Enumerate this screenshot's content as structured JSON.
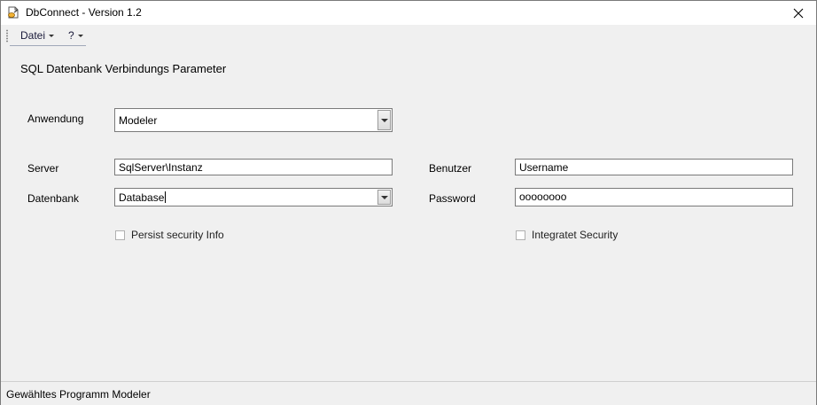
{
  "window": {
    "title": "DbConnect - Version 1.2",
    "close_glyph": "✕"
  },
  "menu": {
    "items": [
      {
        "label": "Datei"
      },
      {
        "label": "?"
      }
    ]
  },
  "form": {
    "heading": "SQL Datenbank Verbindungs Parameter",
    "anwendung_label": "Anwendung",
    "anwendung_value": "Modeler",
    "server_label": "Server",
    "server_value": "SqlServer\\Instanz",
    "datenbank_label": "Datenbank",
    "datenbank_value": "Database",
    "benutzer_label": "Benutzer",
    "benutzer_value": "Username",
    "password_label": "Password",
    "password_value": "oooooooo",
    "persist_label": "Persist security Info",
    "persist_checked": false,
    "integrated_label": "Integratet Security",
    "integrated_checked": false
  },
  "status": {
    "text": "Gewähltes Programm Modeler"
  },
  "icons": {
    "app": "app-icon",
    "close": "close-icon",
    "dropdown": "chevron-down-icon"
  }
}
